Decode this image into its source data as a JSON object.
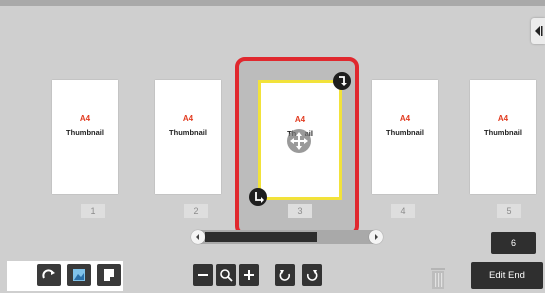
{
  "pages": [
    {
      "paper": "A4",
      "label": "Thumbnail",
      "number": "1"
    },
    {
      "paper": "A4",
      "label": "Thumbnail",
      "number": "2"
    },
    {
      "paper": "A4",
      "label": "Thumbnail",
      "number": "3"
    },
    {
      "paper": "A4",
      "label": "Thumbnail",
      "number": "4"
    },
    {
      "paper": "A4",
      "label": "Thumbnail",
      "number": "5"
    }
  ],
  "selected_page_index": 2,
  "selected_label_visible": "Th    ail",
  "page_count": "6",
  "edit_end_label": "Edit End",
  "scroll_position_fraction": 0.6,
  "icons": {
    "side_tab": "collapse-arrow-icon",
    "rotate_cw_handle": "rotate-clockwise-icon",
    "rotate_ccw_handle": "rotate-counterclockwise-icon",
    "move_handle": "move-icon",
    "tools": [
      "rotate-icon",
      "image-icon",
      "page-icon"
    ],
    "zoom": [
      "zoom-out-icon",
      "zoom-icon",
      "zoom-in-icon",
      "rotate-left-icon",
      "rotate-right-icon"
    ],
    "trash": "trash-icon"
  },
  "colors": {
    "selection_border": "#e0282e",
    "page_highlight": "#f2e23a",
    "paper_size_text": "#e23a1f"
  }
}
